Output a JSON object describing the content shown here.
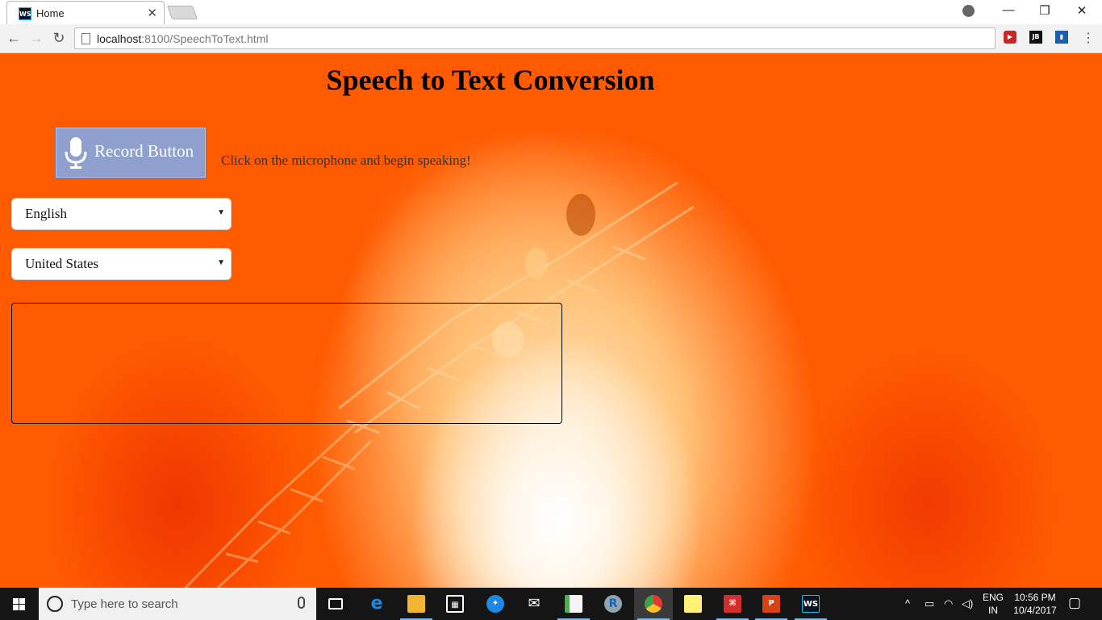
{
  "browser": {
    "tab_title": "Home",
    "tab_favicon": "WS",
    "url_host": "localhost",
    "url_path": ":8100/SpeechToText.html",
    "extensions": [
      {
        "name": "cast-extension-icon",
        "color": "#c62828"
      },
      {
        "name": "jb-extension-icon",
        "label": "JB",
        "color": "#111111"
      },
      {
        "name": "bookmark-extension-icon",
        "color": "#1a5fb4"
      }
    ]
  },
  "page": {
    "title": "Speech to Text Conversion",
    "record_button_label": "Record Button",
    "hint": "Click on the microphone and begin speaking!",
    "language_select": {
      "value": "English"
    },
    "dialect_select": {
      "value": "United States"
    },
    "transcript": ""
  },
  "taskbar": {
    "search_placeholder": "Type here to search",
    "apps": [
      {
        "name": "task-view-icon",
        "color": "#151515"
      },
      {
        "name": "edge-icon",
        "color": "#1e88e5"
      },
      {
        "name": "file-explorer-icon",
        "color": "#f2b632"
      },
      {
        "name": "store-icon",
        "color": "#ffffff"
      },
      {
        "name": "safari-icon",
        "color": "#1e88e5"
      },
      {
        "name": "mail-icon",
        "color": "#ffffff"
      },
      {
        "name": "office-icon",
        "color": "#4caf50"
      },
      {
        "name": "r-icon",
        "color": "#1565c0"
      },
      {
        "name": "chrome-icon",
        "color": "#e53935"
      },
      {
        "name": "sticky-notes-icon",
        "color": "#fff176"
      },
      {
        "name": "acrobat-icon",
        "color": "#d32f2f"
      },
      {
        "name": "powerpoint-icon",
        "color": "#d84315"
      },
      {
        "name": "webstorm-icon",
        "color": "#0b1521"
      }
    ],
    "language": "ENG",
    "region": "IN",
    "time": "10:56 PM",
    "date": "10/4/2017"
  }
}
